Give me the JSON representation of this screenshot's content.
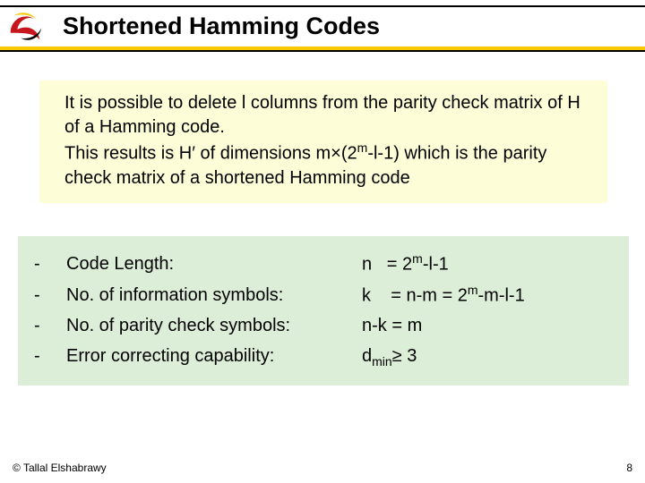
{
  "title": "Shortened Hamming Codes",
  "intro": {
    "line1": "It is possible to delete l columns from the parity check matrix of H of a Hamming code.",
    "line2a": "This results is H",
    "line2b": " of dimensions m×(2",
    "line2c": "-l-1) which is the parity check matrix of a shortened Hamming code",
    "prime": "′",
    "sup_m": "m"
  },
  "params": [
    {
      "label": "Code Length:",
      "var": "n",
      "eq_pre": " = 2",
      "sup": "m",
      "eq_post": "-l-1"
    },
    {
      "label": "No. of information symbols:",
      "var": "k",
      "eq_pre": " = n-m = 2",
      "sup": "m",
      "eq_post": "-m-l-1"
    },
    {
      "label": "No. of parity check symbols:",
      "var": "n-k",
      "eq_pre": " = m",
      "sup": "",
      "eq_post": ""
    },
    {
      "label": "Error correcting capability:",
      "var": "d",
      "sub": "min",
      "eq_pre": "≥ 3",
      "sup": "",
      "eq_post": ""
    }
  ],
  "footer": {
    "left": "© Tallal Elshabrawy",
    "right": "8"
  }
}
